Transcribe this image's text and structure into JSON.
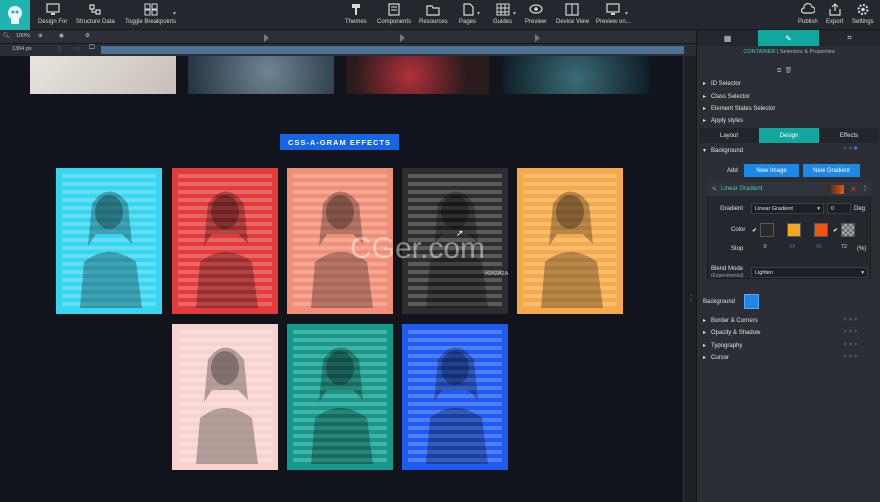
{
  "toolbar": {
    "design_for": "Design For",
    "structure_data": "Structure Data",
    "toggle_breakpoints": "Toggle Breakpoints",
    "themes": "Themes",
    "components": "Components",
    "resources": "Resources",
    "pages": "Pages",
    "guides": "Guides",
    "preview": "Preview",
    "device_view": "Device View",
    "preview_on": "Preview on...",
    "publish": "Publish",
    "export": "Export",
    "settings": "Settings"
  },
  "subbar": {
    "zoom": "100%",
    "width": "1304 px"
  },
  "canvas": {
    "badge": "CSS-A-GRAM EFFECTS",
    "color_tag": "#2A2A2A",
    "watermark": "CGer.com",
    "cards_row1": [
      "#38d5f0",
      "#e23b3b",
      "#f08e77",
      "#2d2d2f",
      "#f5a94a"
    ],
    "cards_row2": [
      "#f7d3cf",
      "#139a8b",
      "#1f5bf0"
    ]
  },
  "panel": {
    "crumb_container": "CONTAINER",
    "crumb_rest": " | Selectors & Properties",
    "selectors": [
      "ID Selector",
      "Class Selector",
      "Element States Selector",
      "Apply styles"
    ],
    "tabs": [
      "Layout",
      "Design",
      "Effects"
    ],
    "background_section": "Background",
    "add_label": "Add",
    "new_image": "New Image",
    "new_gradient": "New Gradient",
    "gradient_title": "Linear Gradient",
    "gradient_label": "Gradient",
    "gradient_value": "Linear Gradient",
    "angle": "0",
    "angle_unit": "Deg",
    "color_label": "Color",
    "stop_label": "Stop",
    "stops": [
      "0",
      "33",
      "66",
      "72"
    ],
    "stop_unit": "(%)",
    "blend_label": "Blend Mode",
    "blend_sub": "(Experimental)",
    "blend_value": "Lighten",
    "background_label": "Background",
    "sections": [
      "Border & Corners",
      "Opacity & Shadow",
      "Typography",
      "Cursor"
    ],
    "swatch_colors": [
      "#2a2a2a",
      "#f2a81d",
      "#f2540f"
    ]
  }
}
